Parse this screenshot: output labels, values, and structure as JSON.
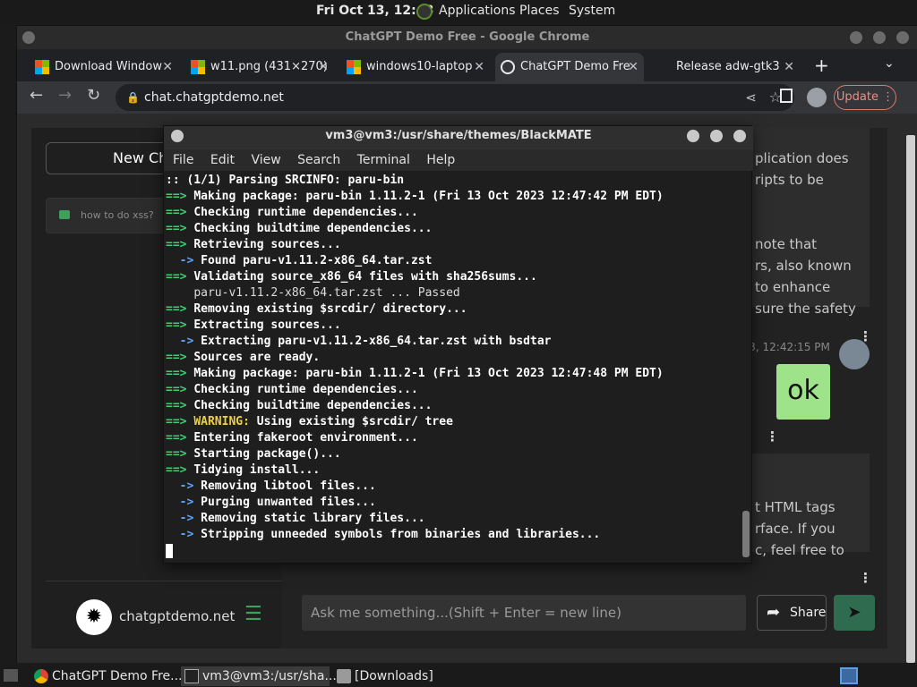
{
  "top_panel": {
    "clock": "Fri Oct 13, 12:48",
    "menus": [
      "Applications",
      "Places",
      "System"
    ]
  },
  "chrome": {
    "window_title": "ChatGPT Demo Free - Google Chrome",
    "tabs": [
      {
        "label": "Download Window",
        "icon": "windows-logo-icon"
      },
      {
        "label": "w11.png (431×270)",
        "icon": "windows-logo-icon"
      },
      {
        "label": "windows10-laptop",
        "icon": "windows-logo-icon"
      },
      {
        "label": "ChatGPT Demo Fre",
        "icon": "globe-icon",
        "active": true
      },
      {
        "label": "Release adw-gtk3",
        "icon": "github-icon"
      }
    ],
    "url": "chat.chatgptdemo.net",
    "update_label": "Update"
  },
  "page": {
    "new_chat_label": "New Ch",
    "history_item": "how to do xss?",
    "brand": "chatgptdemo.net",
    "right_snippets": [
      "plication does",
      "ripts to be",
      "note that",
      "rs, also known",
      "to enhance",
      "sure the safety"
    ],
    "timestamp": "023, 12:42:15 PM",
    "ok_message": "ok",
    "snippets_2": [
      "t HTML tags",
      "rface. If you",
      "c, feel free to"
    ],
    "input_placeholder": "Ask me something...(Shift + Enter = new line)",
    "share_label": "Share"
  },
  "terminal": {
    "title": "vm3@vm3:/usr/share/themes/BlackMATE",
    "menu": [
      "File",
      "Edit",
      "View",
      "Search",
      "Terminal",
      "Help"
    ],
    "lines": [
      {
        "prefix": ":: ",
        "kind": "plain-bold",
        "text": "(1/1) Parsing SRCINFO: paru-bin"
      },
      {
        "prefix": "==> ",
        "kind": "g",
        "text": "Making package: paru-bin 1.11.2-1 (Fri 13 Oct 2023 12:47:42 PM EDT)"
      },
      {
        "prefix": "==> ",
        "kind": "g",
        "text": "Checking runtime dependencies..."
      },
      {
        "prefix": "==> ",
        "kind": "g",
        "text": "Checking buildtime dependencies..."
      },
      {
        "prefix": "==> ",
        "kind": "g",
        "text": "Retrieving sources..."
      },
      {
        "prefix": "  -> ",
        "kind": "b",
        "text": "Found paru-v1.11.2-x86_64.tar.zst"
      },
      {
        "prefix": "==> ",
        "kind": "g",
        "text": "Validating source_x86_64 files with sha256sums..."
      },
      {
        "prefix": "    ",
        "kind": "plain",
        "text": "paru-v1.11.2-x86_64.tar.zst ... Passed"
      },
      {
        "prefix": "==> ",
        "kind": "g",
        "text": "Removing existing $srcdir/ directory..."
      },
      {
        "prefix": "==> ",
        "kind": "g",
        "text": "Extracting sources..."
      },
      {
        "prefix": "  -> ",
        "kind": "b",
        "text": "Extracting paru-v1.11.2-x86_64.tar.zst with bsdtar"
      },
      {
        "prefix": "==> ",
        "kind": "g",
        "text": "Sources are ready."
      },
      {
        "prefix": "==> ",
        "kind": "g",
        "text": "Making package: paru-bin 1.11.2-1 (Fri 13 Oct 2023 12:47:48 PM EDT)"
      },
      {
        "prefix": "==> ",
        "kind": "g",
        "text": "Checking runtime dependencies..."
      },
      {
        "prefix": "==> ",
        "kind": "g",
        "text": "Checking buildtime dependencies..."
      },
      {
        "prefix": "==> ",
        "kind": "w",
        "warn": "WARNING:",
        "text": " Using existing $srcdir/ tree"
      },
      {
        "prefix": "==> ",
        "kind": "g",
        "text": "Entering fakeroot environment..."
      },
      {
        "prefix": "==> ",
        "kind": "g",
        "text": "Starting package()..."
      },
      {
        "prefix": "==> ",
        "kind": "g",
        "text": "Tidying install..."
      },
      {
        "prefix": "  -> ",
        "kind": "b",
        "text": "Removing libtool files..."
      },
      {
        "prefix": "  -> ",
        "kind": "b",
        "text": "Purging unwanted files..."
      },
      {
        "prefix": "  -> ",
        "kind": "b",
        "text": "Removing static library files..."
      },
      {
        "prefix": "  -> ",
        "kind": "b",
        "text": "Stripping unneeded symbols from binaries and libraries..."
      }
    ]
  },
  "taskbar": {
    "items": [
      {
        "label": "ChatGPT Demo Fre...",
        "icon": "chrome-icon"
      },
      {
        "label": "vm3@vm3:/usr/sha...",
        "icon": "terminal-icon",
        "active": true
      },
      {
        "label": "[Downloads]",
        "icon": "folder-icon"
      }
    ]
  },
  "colors": {
    "accent_green": "#3cd070",
    "arrow_blue": "#5ea4ff",
    "warning": "#f0d040",
    "ok_bubble": "#9ee38a"
  }
}
